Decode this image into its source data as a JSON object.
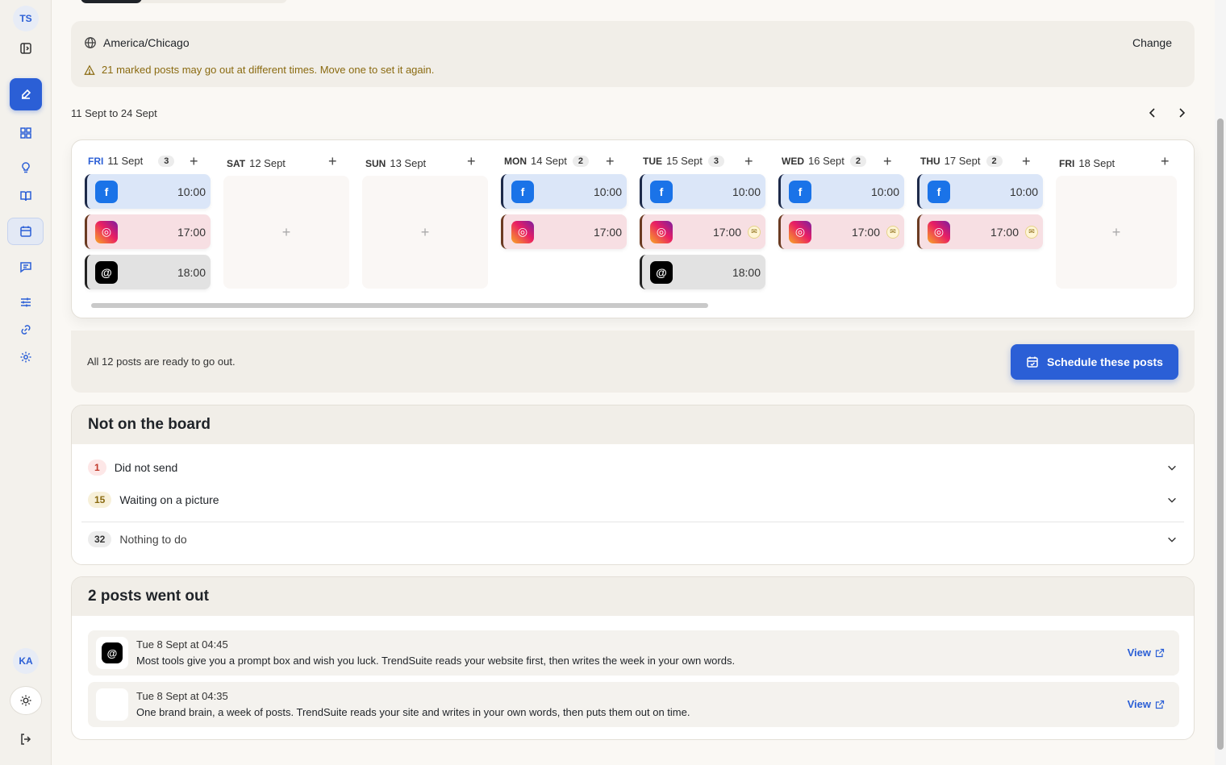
{
  "sidebar": {
    "workspace_initials": "TS",
    "user_initials": "KA"
  },
  "timezone": {
    "name": "America/Chicago",
    "change_label": "Change",
    "warning": "21 marked posts may go out at different times. Move one to set it again."
  },
  "range": "11 Sept to 24 Sept",
  "days": [
    {
      "dow": "FRI",
      "date": "11 Sept",
      "count": "3",
      "today": true
    },
    {
      "dow": "SAT",
      "date": "12 Sept",
      "count": ""
    },
    {
      "dow": "SUN",
      "date": "13 Sept",
      "count": ""
    },
    {
      "dow": "MON",
      "date": "14 Sept",
      "count": "2"
    },
    {
      "dow": "TUE",
      "date": "15 Sept",
      "count": "3"
    },
    {
      "dow": "WED",
      "date": "16 Sept",
      "count": "2"
    },
    {
      "dow": "THU",
      "date": "17 Sept",
      "count": "2"
    },
    {
      "dow": "FRI",
      "date": "18 Sept",
      "count": ""
    }
  ],
  "posts": {
    "fb_time": "10:00",
    "ig_time": "17:00",
    "th_time": "18:00"
  },
  "ready": {
    "text": "All 12 posts are ready to go out.",
    "button_label": "Schedule these posts"
  },
  "not_on_board": {
    "title": "Not on the board",
    "rows": [
      {
        "num": "1",
        "label": "Did not send"
      },
      {
        "num": "15",
        "label": "Waiting on a picture"
      },
      {
        "num": "32",
        "label": "Nothing to do"
      }
    ]
  },
  "went_out": {
    "title": "2 posts went out",
    "items": [
      {
        "when": "Tue 8 Sept at 04:45",
        "text": "Most tools give you a prompt box and wish you luck. TrendSuite reads your website first, then writes the week in your own words.",
        "view": "View"
      },
      {
        "when": "Tue 8 Sept at 04:35",
        "text": "One brand brain, a week of posts. TrendSuite reads your site and writes in your own words, then puts them out on time.",
        "view": "View"
      }
    ]
  },
  "colors": {
    "accent": "#2b5fd6",
    "facebook": "#1a73e8",
    "warning_text": "#8a6a10"
  }
}
